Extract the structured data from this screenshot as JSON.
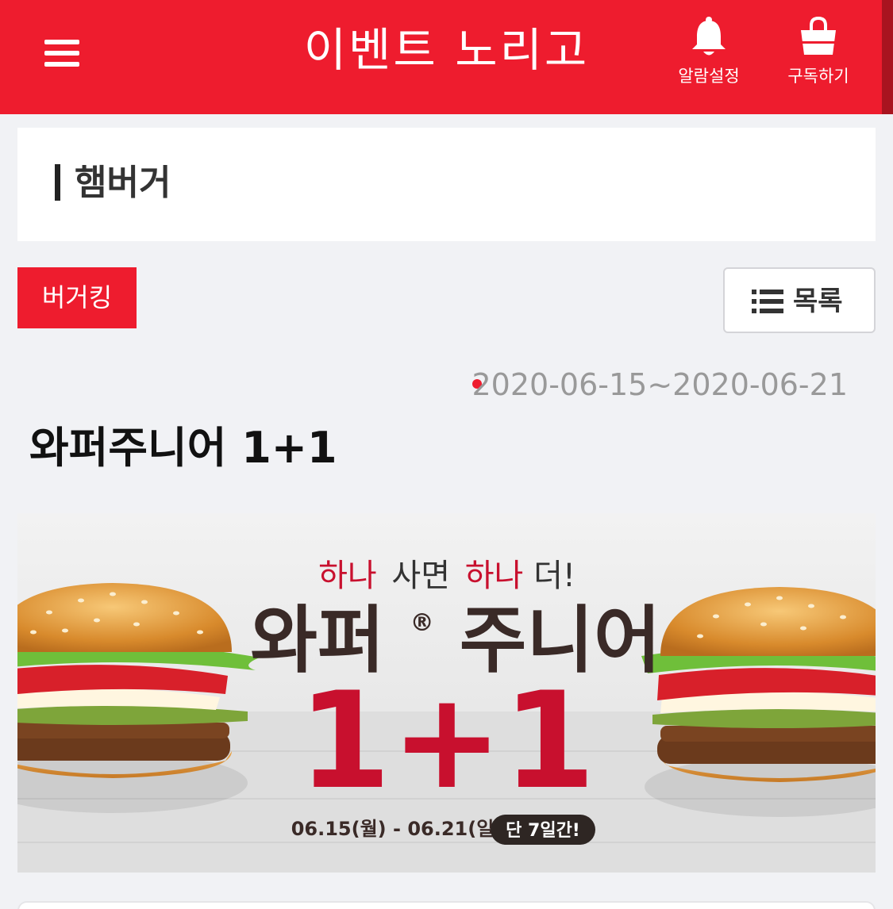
{
  "header": {
    "title": "이벤트 노리고",
    "alarm_label": "알람설정",
    "subscribe_label": "구독하기"
  },
  "section": {
    "title": "햄버거"
  },
  "brand_tag": "버거킹",
  "list_button_label": "목록",
  "event": {
    "date_range": "2020-06-15~2020-06-21",
    "title": "와퍼주니어 1+1"
  },
  "banner": {
    "headline_1": "하나",
    "headline_2": "사면",
    "headline_3": "하나",
    "headline_4": "더!",
    "product": "와퍼",
    "product_mark": "®",
    "product_2": "주니어",
    "offer": "1+1",
    "dates": "06.15(월) - 06.21(일)",
    "badge": "단 7일간!"
  },
  "colors": {
    "brand_red": "#ee1c2e",
    "banner_red": "#c8102e"
  }
}
